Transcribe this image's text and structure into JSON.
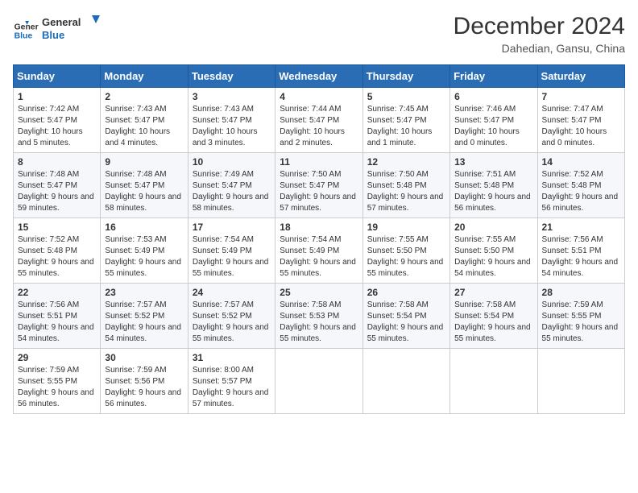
{
  "header": {
    "logo_line1": "General",
    "logo_line2": "Blue",
    "month_title": "December 2024",
    "location": "Dahedian, Gansu, China"
  },
  "weekdays": [
    "Sunday",
    "Monday",
    "Tuesday",
    "Wednesday",
    "Thursday",
    "Friday",
    "Saturday"
  ],
  "weeks": [
    [
      {
        "day": "1",
        "sunrise": "Sunrise: 7:42 AM",
        "sunset": "Sunset: 5:47 PM",
        "daylight": "Daylight: 10 hours and 5 minutes."
      },
      {
        "day": "2",
        "sunrise": "Sunrise: 7:43 AM",
        "sunset": "Sunset: 5:47 PM",
        "daylight": "Daylight: 10 hours and 4 minutes."
      },
      {
        "day": "3",
        "sunrise": "Sunrise: 7:43 AM",
        "sunset": "Sunset: 5:47 PM",
        "daylight": "Daylight: 10 hours and 3 minutes."
      },
      {
        "day": "4",
        "sunrise": "Sunrise: 7:44 AM",
        "sunset": "Sunset: 5:47 PM",
        "daylight": "Daylight: 10 hours and 2 minutes."
      },
      {
        "day": "5",
        "sunrise": "Sunrise: 7:45 AM",
        "sunset": "Sunset: 5:47 PM",
        "daylight": "Daylight: 10 hours and 1 minute."
      },
      {
        "day": "6",
        "sunrise": "Sunrise: 7:46 AM",
        "sunset": "Sunset: 5:47 PM",
        "daylight": "Daylight: 10 hours and 0 minutes."
      },
      {
        "day": "7",
        "sunrise": "Sunrise: 7:47 AM",
        "sunset": "Sunset: 5:47 PM",
        "daylight": "Daylight: 10 hours and 0 minutes."
      }
    ],
    [
      {
        "day": "8",
        "sunrise": "Sunrise: 7:48 AM",
        "sunset": "Sunset: 5:47 PM",
        "daylight": "Daylight: 9 hours and 59 minutes."
      },
      {
        "day": "9",
        "sunrise": "Sunrise: 7:48 AM",
        "sunset": "Sunset: 5:47 PM",
        "daylight": "Daylight: 9 hours and 58 minutes."
      },
      {
        "day": "10",
        "sunrise": "Sunrise: 7:49 AM",
        "sunset": "Sunset: 5:47 PM",
        "daylight": "Daylight: 9 hours and 58 minutes."
      },
      {
        "day": "11",
        "sunrise": "Sunrise: 7:50 AM",
        "sunset": "Sunset: 5:47 PM",
        "daylight": "Daylight: 9 hours and 57 minutes."
      },
      {
        "day": "12",
        "sunrise": "Sunrise: 7:50 AM",
        "sunset": "Sunset: 5:48 PM",
        "daylight": "Daylight: 9 hours and 57 minutes."
      },
      {
        "day": "13",
        "sunrise": "Sunrise: 7:51 AM",
        "sunset": "Sunset: 5:48 PM",
        "daylight": "Daylight: 9 hours and 56 minutes."
      },
      {
        "day": "14",
        "sunrise": "Sunrise: 7:52 AM",
        "sunset": "Sunset: 5:48 PM",
        "daylight": "Daylight: 9 hours and 56 minutes."
      }
    ],
    [
      {
        "day": "15",
        "sunrise": "Sunrise: 7:52 AM",
        "sunset": "Sunset: 5:48 PM",
        "daylight": "Daylight: 9 hours and 55 minutes."
      },
      {
        "day": "16",
        "sunrise": "Sunrise: 7:53 AM",
        "sunset": "Sunset: 5:49 PM",
        "daylight": "Daylight: 9 hours and 55 minutes."
      },
      {
        "day": "17",
        "sunrise": "Sunrise: 7:54 AM",
        "sunset": "Sunset: 5:49 PM",
        "daylight": "Daylight: 9 hours and 55 minutes."
      },
      {
        "day": "18",
        "sunrise": "Sunrise: 7:54 AM",
        "sunset": "Sunset: 5:49 PM",
        "daylight": "Daylight: 9 hours and 55 minutes."
      },
      {
        "day": "19",
        "sunrise": "Sunrise: 7:55 AM",
        "sunset": "Sunset: 5:50 PM",
        "daylight": "Daylight: 9 hours and 55 minutes."
      },
      {
        "day": "20",
        "sunrise": "Sunrise: 7:55 AM",
        "sunset": "Sunset: 5:50 PM",
        "daylight": "Daylight: 9 hours and 54 minutes."
      },
      {
        "day": "21",
        "sunrise": "Sunrise: 7:56 AM",
        "sunset": "Sunset: 5:51 PM",
        "daylight": "Daylight: 9 hours and 54 minutes."
      }
    ],
    [
      {
        "day": "22",
        "sunrise": "Sunrise: 7:56 AM",
        "sunset": "Sunset: 5:51 PM",
        "daylight": "Daylight: 9 hours and 54 minutes."
      },
      {
        "day": "23",
        "sunrise": "Sunrise: 7:57 AM",
        "sunset": "Sunset: 5:52 PM",
        "daylight": "Daylight: 9 hours and 54 minutes."
      },
      {
        "day": "24",
        "sunrise": "Sunrise: 7:57 AM",
        "sunset": "Sunset: 5:52 PM",
        "daylight": "Daylight: 9 hours and 55 minutes."
      },
      {
        "day": "25",
        "sunrise": "Sunrise: 7:58 AM",
        "sunset": "Sunset: 5:53 PM",
        "daylight": "Daylight: 9 hours and 55 minutes."
      },
      {
        "day": "26",
        "sunrise": "Sunrise: 7:58 AM",
        "sunset": "Sunset: 5:54 PM",
        "daylight": "Daylight: 9 hours and 55 minutes."
      },
      {
        "day": "27",
        "sunrise": "Sunrise: 7:58 AM",
        "sunset": "Sunset: 5:54 PM",
        "daylight": "Daylight: 9 hours and 55 minutes."
      },
      {
        "day": "28",
        "sunrise": "Sunrise: 7:59 AM",
        "sunset": "Sunset: 5:55 PM",
        "daylight": "Daylight: 9 hours and 55 minutes."
      }
    ],
    [
      {
        "day": "29",
        "sunrise": "Sunrise: 7:59 AM",
        "sunset": "Sunset: 5:55 PM",
        "daylight": "Daylight: 9 hours and 56 minutes."
      },
      {
        "day": "30",
        "sunrise": "Sunrise: 7:59 AM",
        "sunset": "Sunset: 5:56 PM",
        "daylight": "Daylight: 9 hours and 56 minutes."
      },
      {
        "day": "31",
        "sunrise": "Sunrise: 8:00 AM",
        "sunset": "Sunset: 5:57 PM",
        "daylight": "Daylight: 9 hours and 57 minutes."
      },
      null,
      null,
      null,
      null
    ]
  ]
}
